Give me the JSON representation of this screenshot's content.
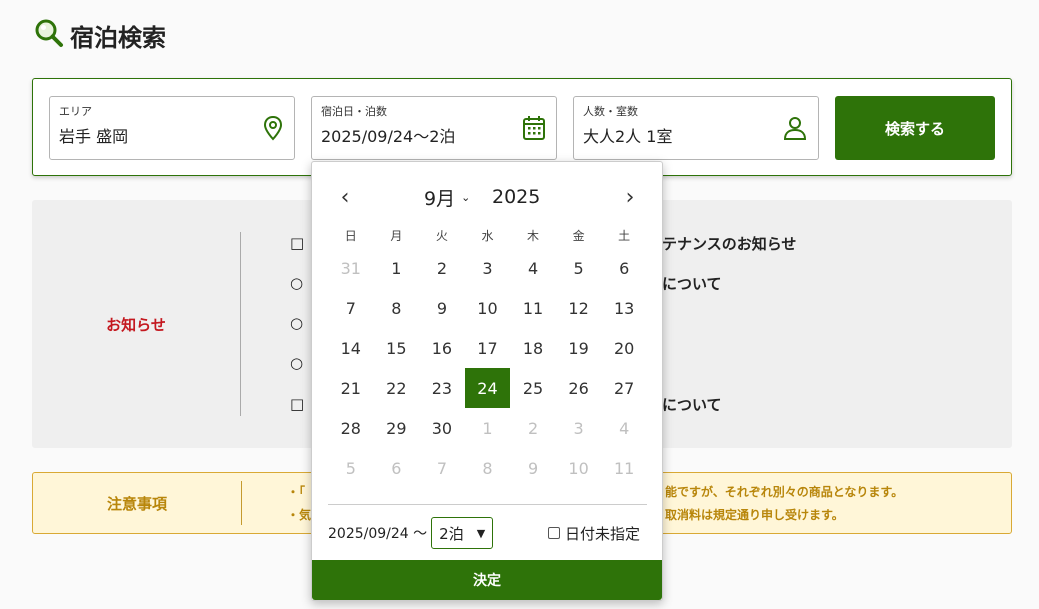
{
  "page": {
    "title": "宿泊検索"
  },
  "search": {
    "area": {
      "label": "エリア",
      "value": "岩手 盛岡"
    },
    "dates": {
      "label": "宿泊日・泊数",
      "value": "2025/09/24〜2泊"
    },
    "guests": {
      "label": "人数・室数",
      "value": "大人2人 1室"
    },
    "button_label": "検索する"
  },
  "notices": {
    "heading": "お知らせ",
    "items": [
      {
        "bullet": "□",
        "text": "テナンスのお知らせ"
      },
      {
        "bullet": "○",
        "text": "について"
      },
      {
        "bullet": "○",
        "text": ""
      },
      {
        "bullet": "○",
        "text": ""
      },
      {
        "bullet": "□",
        "text": "について"
      }
    ]
  },
  "caution": {
    "heading": "注意事項",
    "lines": [
      {
        "prefix": "・「",
        "text": "能ですが、それぞれ別々の商品となります。"
      },
      {
        "prefix": "・気",
        "text": "取消料は規定通り申し受けます。"
      }
    ]
  },
  "calendar": {
    "prev_label": "‹",
    "next_label": "›",
    "month": "9月",
    "year": "2025",
    "weekdays": [
      "日",
      "月",
      "火",
      "水",
      "木",
      "金",
      "土"
    ],
    "days": [
      {
        "d": "31",
        "m": true
      },
      {
        "d": "1"
      },
      {
        "d": "2"
      },
      {
        "d": "3"
      },
      {
        "d": "4"
      },
      {
        "d": "5"
      },
      {
        "d": "6"
      },
      {
        "d": "7"
      },
      {
        "d": "8"
      },
      {
        "d": "9"
      },
      {
        "d": "10"
      },
      {
        "d": "11"
      },
      {
        "d": "12"
      },
      {
        "d": "13"
      },
      {
        "d": "14"
      },
      {
        "d": "15"
      },
      {
        "d": "16"
      },
      {
        "d": "17"
      },
      {
        "d": "18"
      },
      {
        "d": "19"
      },
      {
        "d": "20"
      },
      {
        "d": "21"
      },
      {
        "d": "22"
      },
      {
        "d": "23"
      },
      {
        "d": "24",
        "s": true
      },
      {
        "d": "25"
      },
      {
        "d": "26"
      },
      {
        "d": "27"
      },
      {
        "d": "28"
      },
      {
        "d": "29"
      },
      {
        "d": "30"
      },
      {
        "d": "1",
        "m": true
      },
      {
        "d": "2",
        "m": true
      },
      {
        "d": "3",
        "m": true
      },
      {
        "d": "4",
        "m": true
      },
      {
        "d": "5",
        "m": true
      },
      {
        "d": "6",
        "m": true
      },
      {
        "d": "7",
        "m": true
      },
      {
        "d": "8",
        "m": true
      },
      {
        "d": "9",
        "m": true
      },
      {
        "d": "10",
        "m": true
      },
      {
        "d": "11",
        "m": true
      }
    ],
    "checkin_text": "2025/09/24 〜",
    "nights_value": "2泊",
    "undated_label": "日付未指定",
    "confirm_label": "決定"
  },
  "colors": {
    "accent": "#2e7309",
    "notice_red": "#c4181f",
    "caution_gold": "#b8860b"
  },
  "icons": {
    "title": "magnifier-icon",
    "area": "map-pin-icon",
    "dates": "calendar-icon",
    "guests": "person-icon"
  }
}
